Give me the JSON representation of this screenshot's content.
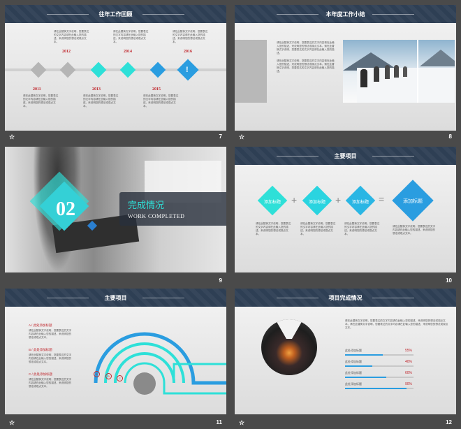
{
  "slides": {
    "s7": {
      "title": "往年工作回顾",
      "num": "7",
      "years_top": [
        "2012",
        "2014",
        "2016"
      ],
      "years_bottom": [
        "2011",
        "2013",
        "2015"
      ],
      "text": "请在此替换文字说明，您要表达的文字内容请在此输入您的描述，来说明您的想法或观点文本。"
    },
    "s8": {
      "title": "本年度工作小结",
      "num": "8",
      "text": "请在此替换文字说明，您要表达的文字内容请在此输入您的描述，来说明您的想法或观点文本。请在此替换文字说明，您要表达的文字内容请在此输入您的描述。"
    },
    "s9": {
      "big": "02",
      "title": "完成情况",
      "subtitle": "WORK COMPLETED",
      "num": "9"
    },
    "s10": {
      "title": "主要项目",
      "num": "10",
      "labels": [
        "添加标题",
        "添加标题",
        "添加标题",
        "添加标题"
      ],
      "ops": [
        "+",
        "+",
        "="
      ],
      "text": "请在此替换文字说明，您要表达的文字内容请在此输入您的描述，来说明您的想法或观点文本。"
    },
    "s11": {
      "title": "主要项目",
      "num": "11",
      "items": [
        "A / 此处添加标题",
        "B / 此处添加标题",
        "C / 此处添加标题"
      ],
      "circles": [
        "A",
        "B",
        "C"
      ],
      "text": "请在此替换文字说明，您要表达的文字内容请在此输入您的描述，来说明您的想法或观点文本。"
    },
    "s12": {
      "title": "项目完成情况",
      "num": "12",
      "text": "请在此替换文字说明，您要表达的文字内容请在此输入您的描述，来说明您的想法或观点文本。请在此替换文字说明，您要表达的文字内容请在此输入您的描述，来说明您的想法或观点文本。",
      "bars": [
        {
          "label": "此处添加标题",
          "value": "55%",
          "frac": 0.55
        },
        {
          "label": "此处添加标题",
          "value": "40%",
          "frac": 0.4
        },
        {
          "label": "此处添加标题",
          "value": "60%",
          "frac": 0.6
        },
        {
          "label": "此处添加标题",
          "value": "90%",
          "frac": 0.9
        }
      ]
    }
  },
  "colors": {
    "teal": "#2ee0d8",
    "blue": "#2a9de0",
    "gray": "#b5b5b5",
    "red": "#c0272d",
    "header": "#2e3f54"
  }
}
